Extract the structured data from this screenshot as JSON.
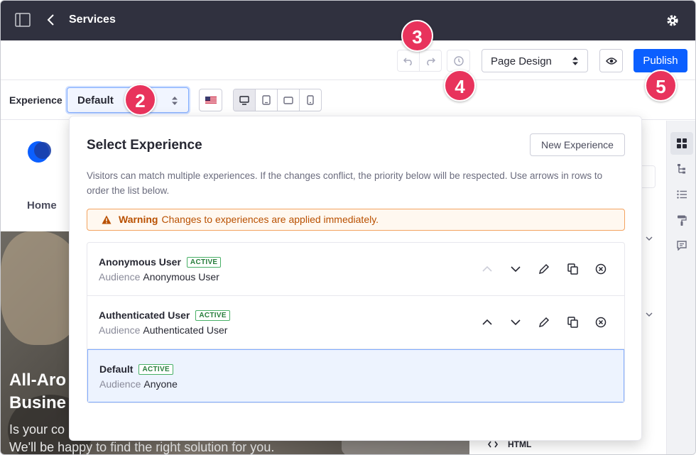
{
  "topbar": {
    "title": "Services"
  },
  "toolbar": {
    "page_design_label": "Page Design",
    "publish_label": "Publish"
  },
  "experience_bar": {
    "label": "Experience",
    "selected": "Default"
  },
  "canvas": {
    "nav_home": "Home",
    "hero_title_line1": "All-Aro",
    "hero_title_line2": "Busine",
    "hero_sub_line1": "Is your co",
    "hero_sub_line2": "We'll be happy to find the right solution for you.",
    "html_item": "HTML"
  },
  "popover": {
    "title": "Select Experience",
    "new_button": "New Experience",
    "description": "Visitors can match multiple experiences. If the changes conflict, the priority below will be respected. Use arrows in rows to order the list below.",
    "warning_label": "Warning",
    "warning_text": "Changes to experiences are applied immediately.",
    "audience_key": "Audience",
    "experiences": [
      {
        "name": "Anonymous User",
        "status": "ACTIVE",
        "audience": "Anonymous User"
      },
      {
        "name": "Authenticated User",
        "status": "ACTIVE",
        "audience": "Authenticated User"
      },
      {
        "name": "Default",
        "status": "ACTIVE",
        "audience": "Anyone"
      }
    ]
  },
  "callouts": [
    "2",
    "3",
    "4",
    "5"
  ],
  "colors": {
    "topbar": "#30313f",
    "primary": "#0b5fff",
    "callout": "#e8335c",
    "active_badge": "#287d3c",
    "warning": "#b95000"
  }
}
